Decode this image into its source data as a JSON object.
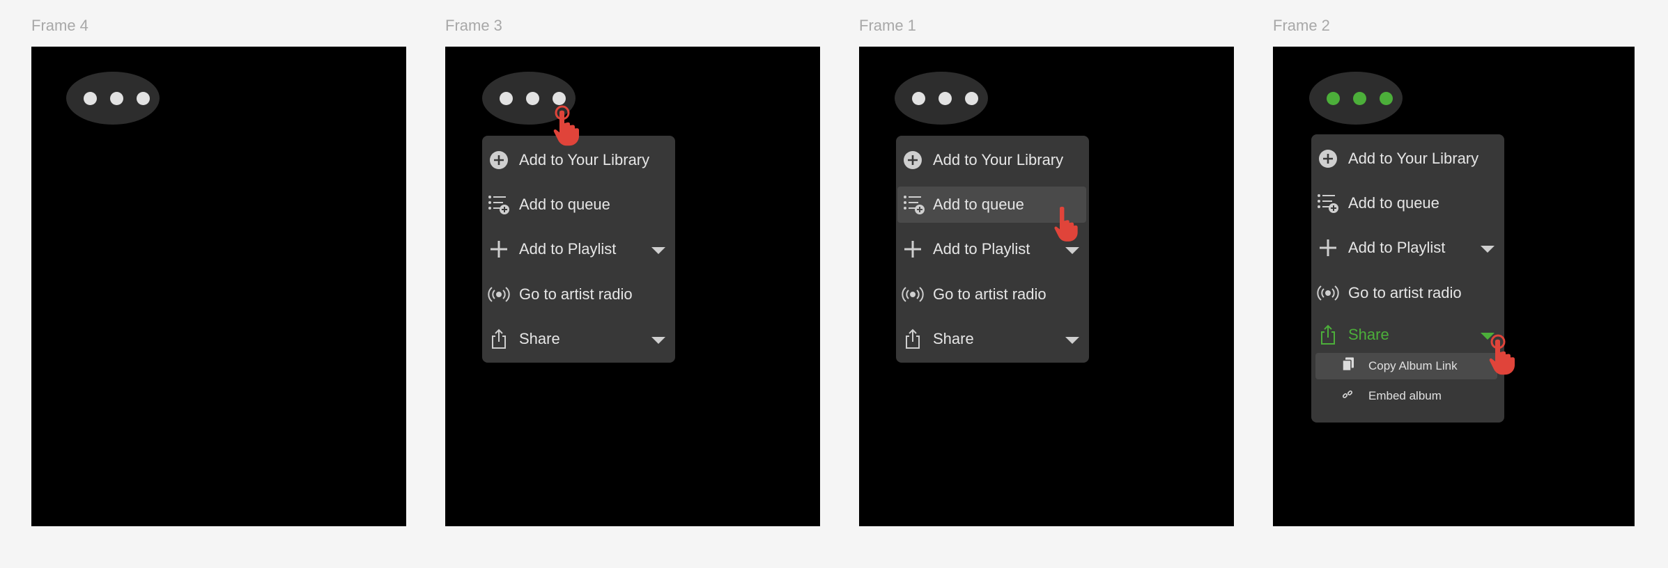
{
  "frames": [
    {
      "label": "Frame 4"
    },
    {
      "label": "Frame 3"
    },
    {
      "label": "Frame 1"
    },
    {
      "label": "Frame 2"
    }
  ],
  "menu": {
    "items": [
      {
        "label": "Add to Your Library",
        "icon": "circle-plus-icon"
      },
      {
        "label": "Add to queue",
        "icon": "queue-add-icon"
      },
      {
        "label": "Add to Playlist",
        "icon": "plus-icon",
        "has_submenu": true
      },
      {
        "label": "Go to artist radio",
        "icon": "radio-icon"
      },
      {
        "label": "Share",
        "icon": "share-icon",
        "has_submenu": true
      }
    ],
    "share_submenu": [
      {
        "label": "Copy Album Link",
        "icon": "copy-icon"
      },
      {
        "label": "Embed album",
        "icon": "link-icon"
      }
    ]
  },
  "colors": {
    "background": "#f5f5f5",
    "frame": "#000000",
    "menu": "#383838",
    "highlight": "#4a4a4a",
    "accent_green": "#4caf3a",
    "cursor_red": "#e0443a"
  }
}
